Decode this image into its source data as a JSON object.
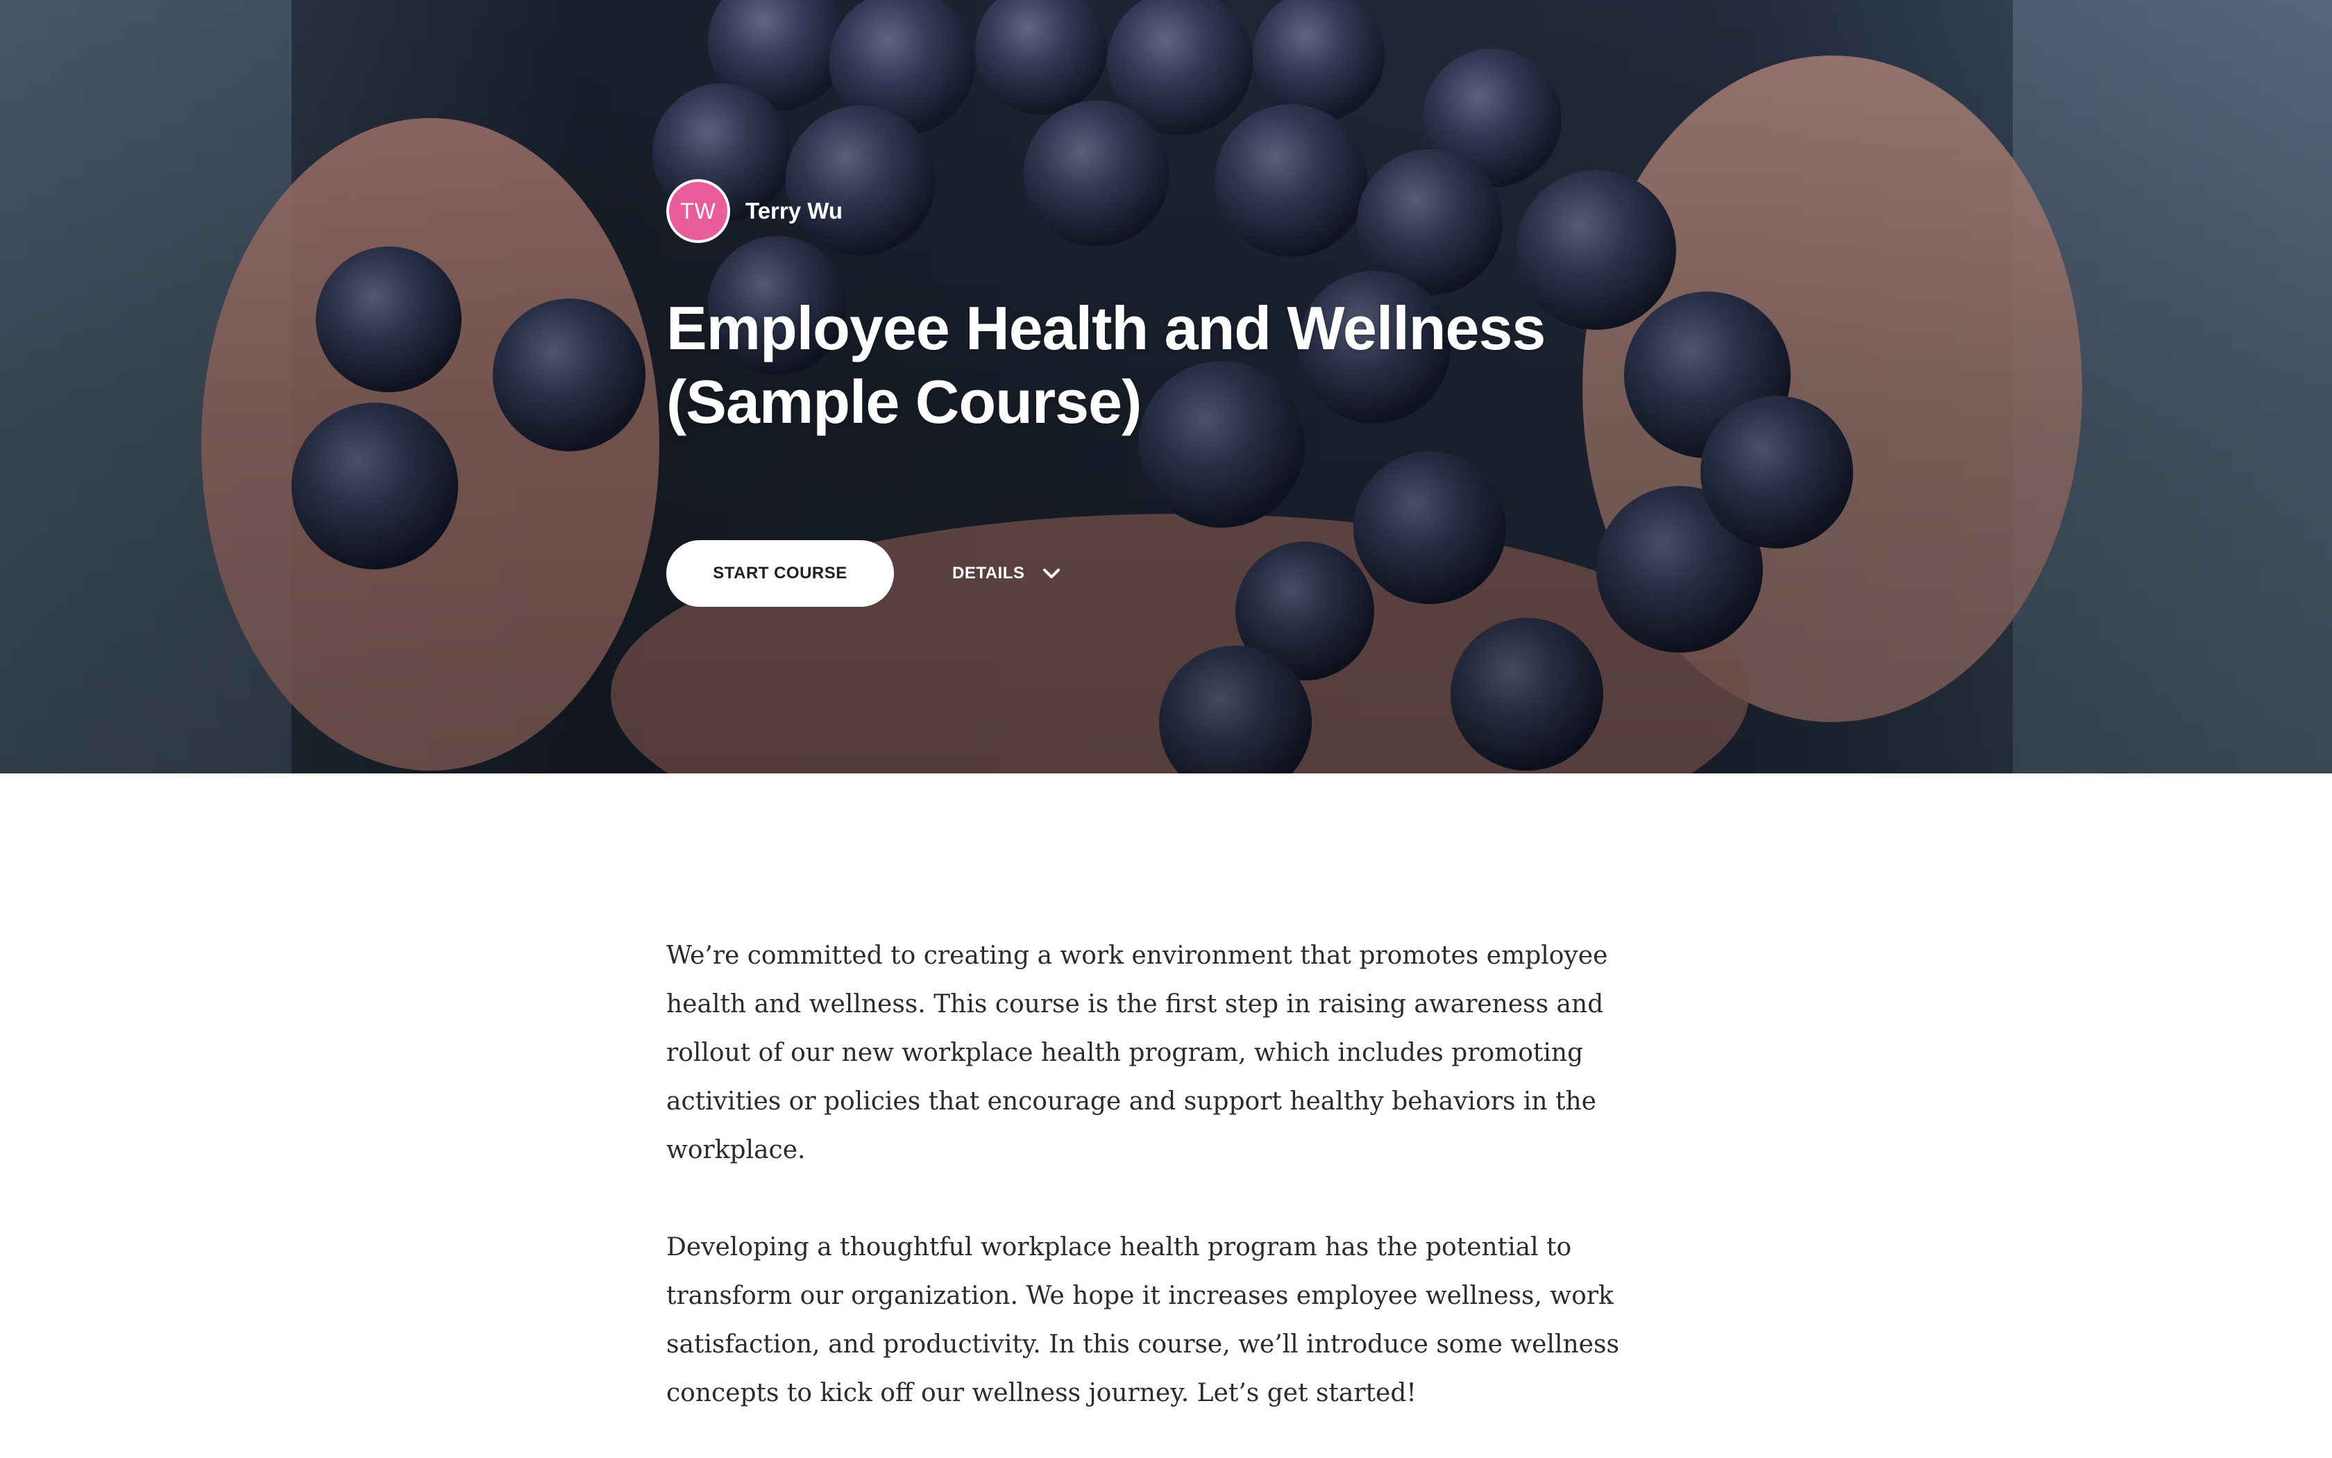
{
  "hero": {
    "author_initials": "TW",
    "author_name": "Terry Wu",
    "title": "Employee Health and Wellness (Sample Course)",
    "start_label": "START COURSE",
    "details_label": "DETAILS",
    "avatar_color": "#e85d9a"
  },
  "description": {
    "paragraphs": [
      "We’re committed to creating a work environment that promotes employee health and wellness. This course is the first step in raising awareness and rollout of our new workplace health program, which includes promoting activities or policies that encourage and support healthy behaviors in the workplace.",
      "Developing a thoughtful workplace health program has the potential to transform our organization. We hope it increases employee wellness, work satisfaction, and productivity. In this course, we’ll introduce some wellness concepts to kick off our wellness journey. Let’s get started!"
    ]
  },
  "icons": {
    "details_toggle": "chevron-down-icon",
    "hero_image": "grapes-in-hands-image"
  }
}
